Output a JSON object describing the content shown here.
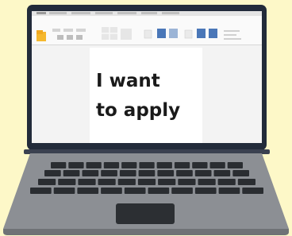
{
  "document": {
    "line1": "I want",
    "line2": "to apply"
  },
  "colors": {
    "background": "#fdf8c8",
    "bezel": "#222b3a",
    "deck": "#8c8f94",
    "keys": "#2a2d31",
    "ribbon_accent": "#4a77b8",
    "folder_accent": "#f5b82e"
  },
  "icons": [
    "folder-icon",
    "ribbon-toolbar",
    "trackpad"
  ]
}
